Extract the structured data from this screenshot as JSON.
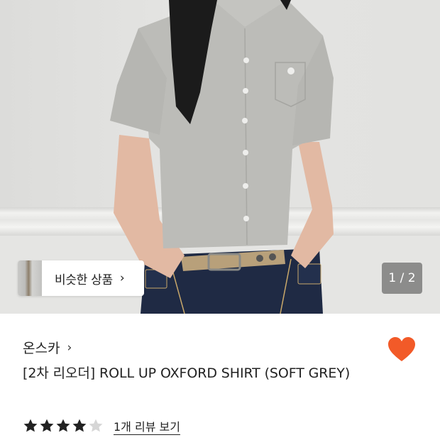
{
  "gallery": {
    "counter": "1 / 2",
    "similar_label": "비슷한 상품",
    "similar_chevron": "›"
  },
  "product": {
    "brand": "온스카",
    "brand_chevron": "›",
    "title": "[2차 리오더] ROLL UP OXFORD SHIRT (SOFT GREY)",
    "rating": 4,
    "rating_max": 5,
    "review_link": "1개 리뷰 보기",
    "wishlisted": true
  },
  "colors": {
    "heart": "#f25a28",
    "star_filled": "#222222",
    "star_empty": "#d6d6d6",
    "counter_bg": "#6e6e6e"
  },
  "icons": {
    "wishlist": "heart-icon",
    "star": "star-icon",
    "chevron": "chevron-right-icon"
  }
}
